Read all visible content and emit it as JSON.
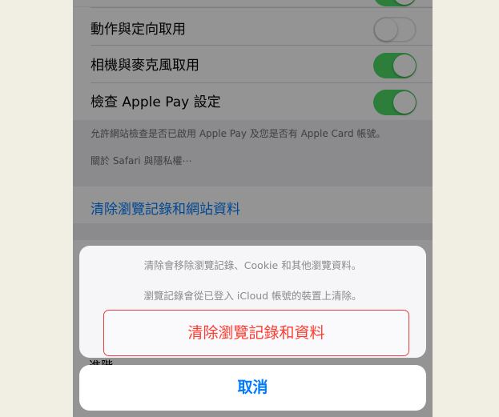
{
  "settings": {
    "rows": [
      {
        "label": "動作與定向取用",
        "toggle": "off"
      },
      {
        "label": "相機與麥克風取用",
        "toggle": "on"
      },
      {
        "label": "檢查 Apple Pay 設定",
        "toggle": "on"
      }
    ],
    "footnote": "允許網站檢查是否已啟用 Apple Pay 及您是否有 Apple Card 帳號。",
    "footnote_link": "關於 Safari 與隱私權⋯",
    "clear_link": "清除瀏覽記錄和網站資料",
    "peek_text": "進階"
  },
  "action_sheet": {
    "message_line1": "清除會移除瀏覽記錄、Cookie 和其他瀏覽資料。",
    "message_line2": "瀏覽記錄會從已登入 iCloud 帳號的裝置上清除。",
    "destructive_label": "清除瀏覽記錄和資料",
    "cancel_label": "取消"
  },
  "colors": {
    "toggle_on": "#4cd964",
    "link_blue": "#007aff",
    "destructive_red": "#ff3b30",
    "highlight_border": "#e8403a"
  }
}
